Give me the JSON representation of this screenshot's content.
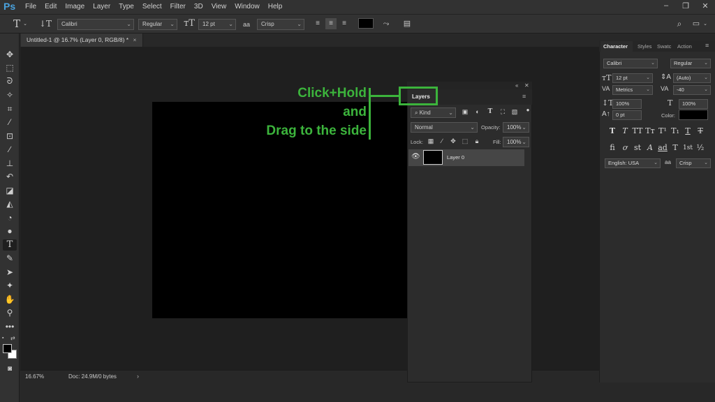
{
  "app": {
    "logo": "Ps"
  },
  "menu": [
    "File",
    "Edit",
    "Image",
    "Layer",
    "Type",
    "Select",
    "Filter",
    "3D",
    "View",
    "Window",
    "Help"
  ],
  "window_controls": [
    "minimize",
    "restore",
    "close"
  ],
  "options_bar": {
    "font_family": "Calibri",
    "font_style": "Regular",
    "font_size": "12 pt",
    "antialias_prefix": "aa",
    "antialias": "Crisp",
    "text_color": "#000000"
  },
  "document_tab": {
    "title": "Untitled-1 @ 16.7% (Layer 0, RGB/8) *",
    "close": "×"
  },
  "status": {
    "zoom": "16.67%",
    "doc": "Doc: 24.9M/0 bytes",
    "arrow": "›"
  },
  "layers_panel": {
    "tab": "Layers",
    "filter_kind": "Kind",
    "blend_mode": "Normal",
    "opacity_label": "Opacity:",
    "opacity_value": "100%",
    "lock_label": "Lock:",
    "fill_label": "Fill:",
    "fill_value": "100%",
    "layers": [
      {
        "name": "Layer 0",
        "visible": true
      }
    ]
  },
  "character_panel": {
    "tabs": [
      "Character",
      "Styles",
      "Swatc",
      "Action"
    ],
    "font_family": "Calibri",
    "font_style": "Regular",
    "size": "12 pt",
    "leading": "(Auto)",
    "kerning": "Metrics",
    "tracking": "-40",
    "vertical_scale": "100%",
    "horizontal_scale": "100%",
    "baseline": "0 pt",
    "color_label": "Color:",
    "color": "#000000",
    "type_buttons_row1": [
      "T",
      "T",
      "TT",
      "Tт",
      "T¹",
      "T₁",
      "T",
      "T"
    ],
    "type_buttons_row2": [
      "fi",
      "ơ",
      "st",
      "A",
      "ad",
      "T",
      "1st",
      "½"
    ],
    "language": "English: USA",
    "antialias_prefix": "aa",
    "antialias": "Crisp"
  },
  "annotation": {
    "lines": [
      "Click+Hold",
      "and",
      "Drag to the side"
    ],
    "color": "#3cb43c"
  },
  "colors": {
    "accent_green": "#3cb43c",
    "ps_blue": "#4aa3df"
  }
}
